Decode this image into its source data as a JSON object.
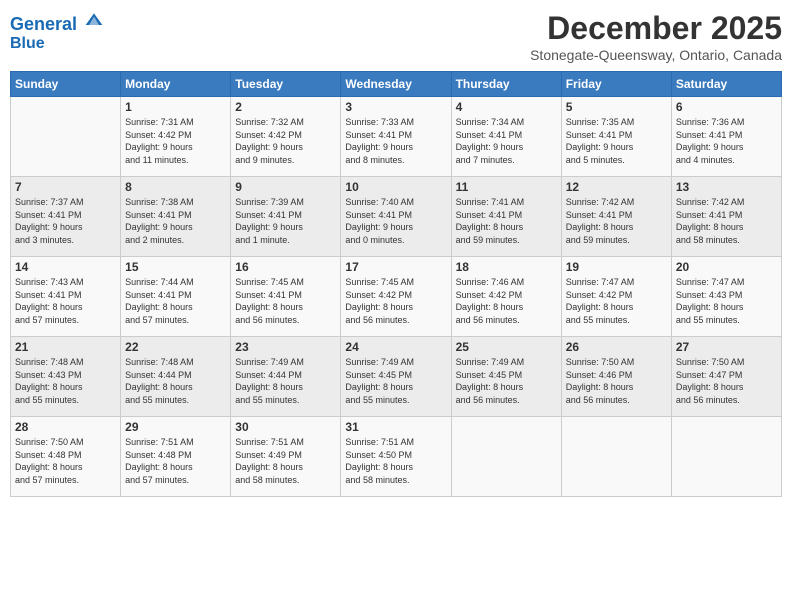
{
  "header": {
    "logo_line1": "General",
    "logo_line2": "Blue",
    "title": "December 2025",
    "location": "Stonegate-Queensway, Ontario, Canada"
  },
  "weekdays": [
    "Sunday",
    "Monday",
    "Tuesday",
    "Wednesday",
    "Thursday",
    "Friday",
    "Saturday"
  ],
  "weeks": [
    [
      {
        "day": "",
        "info": ""
      },
      {
        "day": "1",
        "info": "Sunrise: 7:31 AM\nSunset: 4:42 PM\nDaylight: 9 hours\nand 11 minutes."
      },
      {
        "day": "2",
        "info": "Sunrise: 7:32 AM\nSunset: 4:42 PM\nDaylight: 9 hours\nand 9 minutes."
      },
      {
        "day": "3",
        "info": "Sunrise: 7:33 AM\nSunset: 4:41 PM\nDaylight: 9 hours\nand 8 minutes."
      },
      {
        "day": "4",
        "info": "Sunrise: 7:34 AM\nSunset: 4:41 PM\nDaylight: 9 hours\nand 7 minutes."
      },
      {
        "day": "5",
        "info": "Sunrise: 7:35 AM\nSunset: 4:41 PM\nDaylight: 9 hours\nand 5 minutes."
      },
      {
        "day": "6",
        "info": "Sunrise: 7:36 AM\nSunset: 4:41 PM\nDaylight: 9 hours\nand 4 minutes."
      }
    ],
    [
      {
        "day": "7",
        "info": "Sunrise: 7:37 AM\nSunset: 4:41 PM\nDaylight: 9 hours\nand 3 minutes."
      },
      {
        "day": "8",
        "info": "Sunrise: 7:38 AM\nSunset: 4:41 PM\nDaylight: 9 hours\nand 2 minutes."
      },
      {
        "day": "9",
        "info": "Sunrise: 7:39 AM\nSunset: 4:41 PM\nDaylight: 9 hours\nand 1 minute."
      },
      {
        "day": "10",
        "info": "Sunrise: 7:40 AM\nSunset: 4:41 PM\nDaylight: 9 hours\nand 0 minutes."
      },
      {
        "day": "11",
        "info": "Sunrise: 7:41 AM\nSunset: 4:41 PM\nDaylight: 8 hours\nand 59 minutes."
      },
      {
        "day": "12",
        "info": "Sunrise: 7:42 AM\nSunset: 4:41 PM\nDaylight: 8 hours\nand 59 minutes."
      },
      {
        "day": "13",
        "info": "Sunrise: 7:42 AM\nSunset: 4:41 PM\nDaylight: 8 hours\nand 58 minutes."
      }
    ],
    [
      {
        "day": "14",
        "info": "Sunrise: 7:43 AM\nSunset: 4:41 PM\nDaylight: 8 hours\nand 57 minutes."
      },
      {
        "day": "15",
        "info": "Sunrise: 7:44 AM\nSunset: 4:41 PM\nDaylight: 8 hours\nand 57 minutes."
      },
      {
        "day": "16",
        "info": "Sunrise: 7:45 AM\nSunset: 4:41 PM\nDaylight: 8 hours\nand 56 minutes."
      },
      {
        "day": "17",
        "info": "Sunrise: 7:45 AM\nSunset: 4:42 PM\nDaylight: 8 hours\nand 56 minutes."
      },
      {
        "day": "18",
        "info": "Sunrise: 7:46 AM\nSunset: 4:42 PM\nDaylight: 8 hours\nand 56 minutes."
      },
      {
        "day": "19",
        "info": "Sunrise: 7:47 AM\nSunset: 4:42 PM\nDaylight: 8 hours\nand 55 minutes."
      },
      {
        "day": "20",
        "info": "Sunrise: 7:47 AM\nSunset: 4:43 PM\nDaylight: 8 hours\nand 55 minutes."
      }
    ],
    [
      {
        "day": "21",
        "info": "Sunrise: 7:48 AM\nSunset: 4:43 PM\nDaylight: 8 hours\nand 55 minutes."
      },
      {
        "day": "22",
        "info": "Sunrise: 7:48 AM\nSunset: 4:44 PM\nDaylight: 8 hours\nand 55 minutes."
      },
      {
        "day": "23",
        "info": "Sunrise: 7:49 AM\nSunset: 4:44 PM\nDaylight: 8 hours\nand 55 minutes."
      },
      {
        "day": "24",
        "info": "Sunrise: 7:49 AM\nSunset: 4:45 PM\nDaylight: 8 hours\nand 55 minutes."
      },
      {
        "day": "25",
        "info": "Sunrise: 7:49 AM\nSunset: 4:45 PM\nDaylight: 8 hours\nand 56 minutes."
      },
      {
        "day": "26",
        "info": "Sunrise: 7:50 AM\nSunset: 4:46 PM\nDaylight: 8 hours\nand 56 minutes."
      },
      {
        "day": "27",
        "info": "Sunrise: 7:50 AM\nSunset: 4:47 PM\nDaylight: 8 hours\nand 56 minutes."
      }
    ],
    [
      {
        "day": "28",
        "info": "Sunrise: 7:50 AM\nSunset: 4:48 PM\nDaylight: 8 hours\nand 57 minutes."
      },
      {
        "day": "29",
        "info": "Sunrise: 7:51 AM\nSunset: 4:48 PM\nDaylight: 8 hours\nand 57 minutes."
      },
      {
        "day": "30",
        "info": "Sunrise: 7:51 AM\nSunset: 4:49 PM\nDaylight: 8 hours\nand 58 minutes."
      },
      {
        "day": "31",
        "info": "Sunrise: 7:51 AM\nSunset: 4:50 PM\nDaylight: 8 hours\nand 58 minutes."
      },
      {
        "day": "",
        "info": ""
      },
      {
        "day": "",
        "info": ""
      },
      {
        "day": "",
        "info": ""
      }
    ]
  ]
}
